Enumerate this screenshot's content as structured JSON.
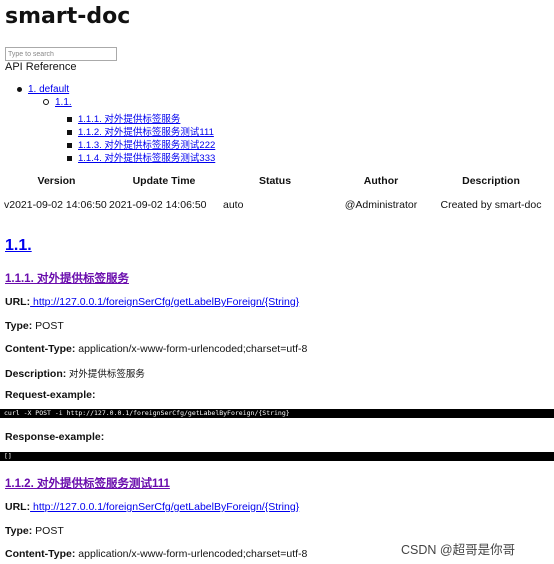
{
  "page": {
    "title": "smart-doc",
    "search_placeholder": "Type to search",
    "api_reference": "API Reference"
  },
  "toc": {
    "l1": "1. default",
    "l2": "1.1.",
    "items": [
      "1.1.1. 对外提供标签服务",
      "1.1.2. 对外提供标签服务测试111",
      "1.1.3. 对外提供标签服务测试222",
      "1.1.4. 对外提供标签服务测试333"
    ]
  },
  "version_table": {
    "headers": [
      "Version",
      "Update Time",
      "Status",
      "Author",
      "Description"
    ],
    "rows": [
      [
        "v2021-09-02 14:06:50",
        "2021-09-02 14:06:50",
        "auto",
        "@Administrator",
        "Created by smart-doc"
      ]
    ]
  },
  "section": {
    "heading": "1.1."
  },
  "apis": [
    {
      "heading": "1.1.1. 对外提供标签服务",
      "url_label": "URL:",
      "url": " http://127.0.0.1/foreignSerCfg/getLabelByForeign/{String}",
      "type_label": "Type:",
      "type": " POST",
      "content_type_label": "Content-Type:",
      "content_type": " application/x-www-form-urlencoded;charset=utf-8",
      "description_label": "Description:",
      "description": " 对外提供标签服务",
      "request_label": "Request-example:",
      "request": "curl -X POST -i http://127.0.0.1/foreignSerCfg/getLabelByForeign/{String}",
      "response_label": "Response-example:",
      "response": "[]"
    },
    {
      "heading": "1.1.2. 对外提供标签服务测试111",
      "url_label": "URL:",
      "url": " http://127.0.0.1/foreignSerCfg/getLabelByForeign/{String}",
      "type_label": "Type:",
      "type": " POST",
      "content_type_label": "Content-Type:",
      "content_type": " application/x-www-form-urlencoded;charset=utf-8"
    }
  ],
  "watermark": "CSDN @超哥是你哥"
}
